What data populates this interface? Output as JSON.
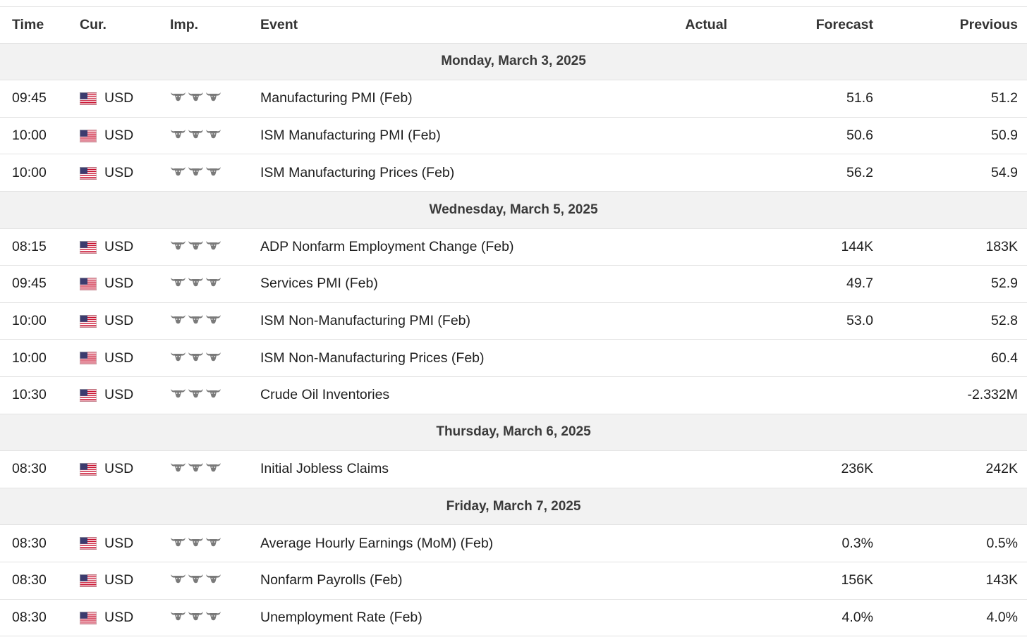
{
  "headers": {
    "time": "Time",
    "currency": "Cur.",
    "importance": "Imp.",
    "event": "Event",
    "actual": "Actual",
    "forecast": "Forecast",
    "previous": "Previous"
  },
  "icons": {
    "flag": "us-flag-icon",
    "importance": "bull-icon"
  },
  "colors": {
    "day_row_bg": "#f2f2f2",
    "border": "#e3e3e3",
    "bull": "#7a7a7a"
  },
  "rows": [
    {
      "type": "day",
      "label": "Monday, March 3, 2025"
    },
    {
      "type": "event",
      "time": "09:45",
      "currency": "USD",
      "importance": 3,
      "event": "Manufacturing PMI (Feb)",
      "actual": "",
      "forecast": "51.6",
      "previous": "51.2"
    },
    {
      "type": "event",
      "time": "10:00",
      "currency": "USD",
      "importance": 3,
      "event": "ISM Manufacturing PMI (Feb)",
      "actual": "",
      "forecast": "50.6",
      "previous": "50.9"
    },
    {
      "type": "event",
      "time": "10:00",
      "currency": "USD",
      "importance": 3,
      "event": "ISM Manufacturing Prices (Feb)",
      "actual": "",
      "forecast": "56.2",
      "previous": "54.9"
    },
    {
      "type": "day",
      "label": "Wednesday, March 5, 2025"
    },
    {
      "type": "event",
      "time": "08:15",
      "currency": "USD",
      "importance": 3,
      "event": "ADP Nonfarm Employment Change (Feb)",
      "actual": "",
      "forecast": "144K",
      "previous": "183K"
    },
    {
      "type": "event",
      "time": "09:45",
      "currency": "USD",
      "importance": 3,
      "event": "Services PMI (Feb)",
      "actual": "",
      "forecast": "49.7",
      "previous": "52.9"
    },
    {
      "type": "event",
      "time": "10:00",
      "currency": "USD",
      "importance": 3,
      "event": "ISM Non-Manufacturing PMI (Feb)",
      "actual": "",
      "forecast": "53.0",
      "previous": "52.8"
    },
    {
      "type": "event",
      "time": "10:00",
      "currency": "USD",
      "importance": 3,
      "event": "ISM Non-Manufacturing Prices (Feb)",
      "actual": "",
      "forecast": "",
      "previous": "60.4"
    },
    {
      "type": "event",
      "time": "10:30",
      "currency": "USD",
      "importance": 3,
      "event": "Crude Oil Inventories",
      "actual": "",
      "forecast": "",
      "previous": "-2.332M"
    },
    {
      "type": "day",
      "label": "Thursday, March 6, 2025"
    },
    {
      "type": "event",
      "time": "08:30",
      "currency": "USD",
      "importance": 3,
      "event": "Initial Jobless Claims",
      "actual": "",
      "forecast": "236K",
      "previous": "242K"
    },
    {
      "type": "day",
      "label": "Friday, March 7, 2025"
    },
    {
      "type": "event",
      "time": "08:30",
      "currency": "USD",
      "importance": 3,
      "event": "Average Hourly Earnings (MoM) (Feb)",
      "actual": "",
      "forecast": "0.3%",
      "previous": "0.5%"
    },
    {
      "type": "event",
      "time": "08:30",
      "currency": "USD",
      "importance": 3,
      "event": "Nonfarm Payrolls (Feb)",
      "actual": "",
      "forecast": "156K",
      "previous": "143K"
    },
    {
      "type": "event",
      "time": "08:30",
      "currency": "USD",
      "importance": 3,
      "event": "Unemployment Rate (Feb)",
      "actual": "",
      "forecast": "4.0%",
      "previous": "4.0%"
    }
  ]
}
